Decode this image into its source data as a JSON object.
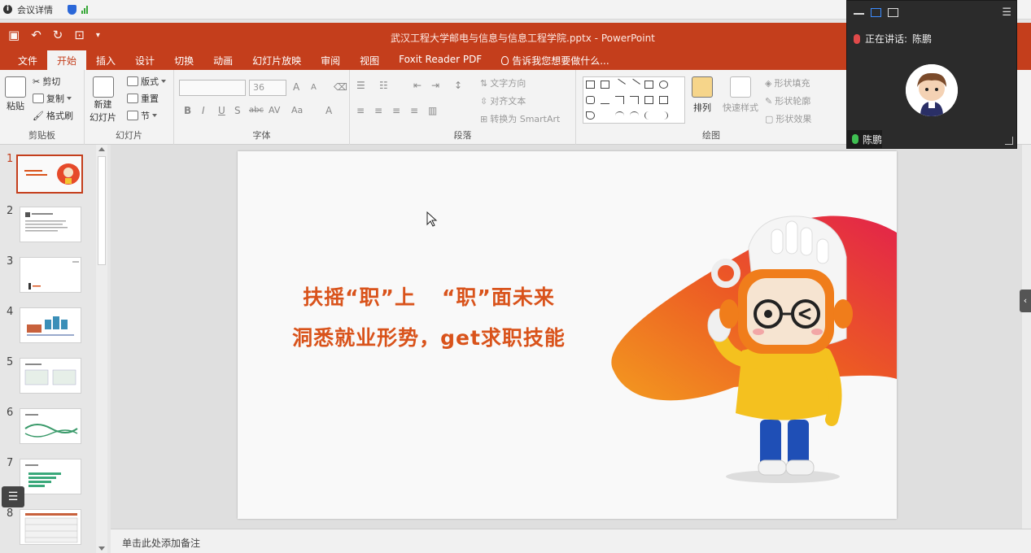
{
  "meeting": {
    "details_label": "会议详情",
    "speaking_prefix": "正在讲话:",
    "speaker_name": "陈鹏",
    "participant_name": "陈鹏"
  },
  "window": {
    "title": "武汉工程大学邮电与信息与信息工程学院.pptx - PowerPoint",
    "accent_color": "#c43e1c"
  },
  "tabs": [
    {
      "label": "文件"
    },
    {
      "label": "开始",
      "active": true
    },
    {
      "label": "插入"
    },
    {
      "label": "设计"
    },
    {
      "label": "切换"
    },
    {
      "label": "动画"
    },
    {
      "label": "幻灯片放映"
    },
    {
      "label": "审阅"
    },
    {
      "label": "视图"
    },
    {
      "label": "Foxit Reader PDF"
    }
  ],
  "tell_me": "告诉我您想要做什么...",
  "ribbon": {
    "clipboard": {
      "paste": "粘贴",
      "cut": "剪切",
      "copy": "复制",
      "format_painter": "格式刷",
      "label": "剪贴板"
    },
    "slides": {
      "new_slide_line1": "新建",
      "new_slide_line2": "幻灯片",
      "layout": "版式",
      "reset": "重置",
      "section": "节",
      "label": "幻灯片"
    },
    "font": {
      "size": "36",
      "label": "字体",
      "bold": "B",
      "italic": "I",
      "underline": "U",
      "shadow": "S",
      "strike": "abc",
      "spacing": "AV",
      "case": "Aa",
      "color": "A",
      "grow": "A",
      "shrink": "A"
    },
    "paragraph": {
      "text_direction": "文字方向",
      "align_text": "对齐文本",
      "smartart": "转换为 SmartArt",
      "label": "段落"
    },
    "drawing": {
      "arrange": "排列",
      "quick_styles": "快速样式",
      "shape_fill": "形状填充",
      "shape_outline": "形状轮廓",
      "shape_effects": "形状效果",
      "label": "绘图"
    }
  },
  "slides": [
    {
      "number": "1",
      "active": true
    },
    {
      "number": "2"
    },
    {
      "number": "3"
    },
    {
      "number": "4"
    },
    {
      "number": "5"
    },
    {
      "number": "6"
    },
    {
      "number": "7"
    },
    {
      "number": "8"
    }
  ],
  "slide": {
    "line1_a": "扶摇“职”上",
    "line1_b": "“职”面未来",
    "line2": "洞悉就业形势，get求职技能",
    "text_color": "#d9531b"
  },
  "notes_placeholder": "单击此处添加备注"
}
